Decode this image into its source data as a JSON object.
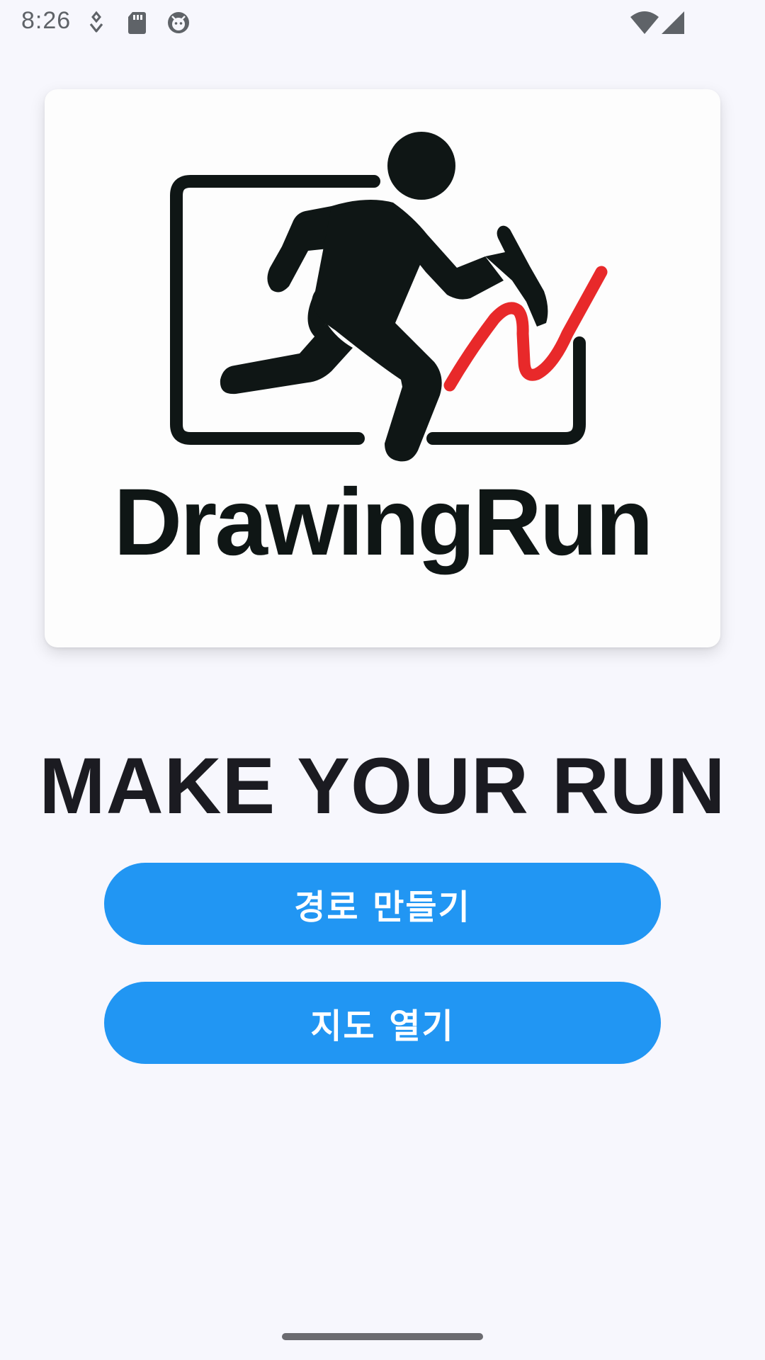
{
  "status_bar": {
    "time": "8:26",
    "icons": [
      "connection-icon",
      "sd-card-icon",
      "app-notification-icon"
    ],
    "right_icons": [
      "wifi-icon",
      "cell-signal-icon"
    ]
  },
  "logo": {
    "wordmark": "DrawingRun",
    "graphic": "runner-drawing-route-logo",
    "accent_color": "#e8292a",
    "ink_color": "#0f1615"
  },
  "headline": "MAKE YOUR RUN",
  "buttons": {
    "create_route_label": "경로 만들기",
    "open_map_label": "지도 열기",
    "color": "#2196f3"
  }
}
